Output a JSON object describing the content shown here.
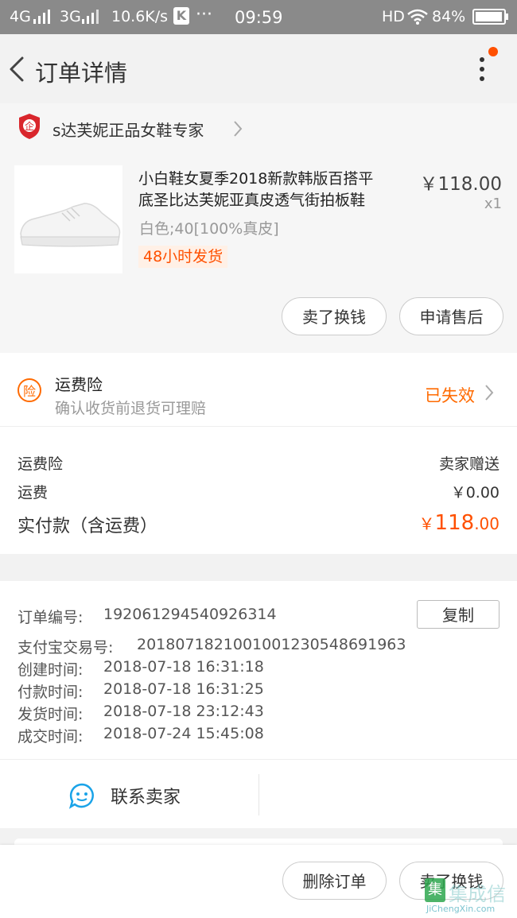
{
  "status_bar": {
    "signal_left": "4G",
    "signal_mid": "3G",
    "speed": "10.6K/s",
    "app_badge": "K",
    "dots": "···",
    "time": "09:59",
    "hd": "HD",
    "battery": "84%"
  },
  "nav": {
    "title": "订单详情",
    "accent": "#ff5000"
  },
  "store": {
    "name": "s达芙妮正品女鞋专家"
  },
  "product": {
    "title_line1": "小白鞋女夏季2018新款韩版百搭平",
    "title_line2": "底圣比达芙妮亚真皮透气街拍板鞋",
    "price": "￥118.00",
    "quantity": "x1",
    "sku": "白色;40[100%真皮]",
    "shipping_tag": "48小时发货",
    "btn_resell": "卖了换钱",
    "btn_aftersale": "申请售后"
  },
  "insurance": {
    "icon_char": "险",
    "title": "运费险",
    "subtitle": "确认收货前退货可理赔",
    "status": "已失效"
  },
  "fees": {
    "insurance_label": "运费险",
    "insurance_value": "卖家赠送",
    "shipping_label": "运费",
    "shipping_value": "￥0.00",
    "total_label": "实付款（含运费）",
    "total_currency": "￥",
    "total_int": "118",
    "total_dec": ".00"
  },
  "order_info": {
    "order_no_label": "订单编号:",
    "order_no": "192061294540926314",
    "copy_label": "复制",
    "alipay_label": "支付宝交易号:",
    "alipay_no": "2018071821001001230548691963",
    "created_label": "创建时间:",
    "created": "2018-07-18 16:31:18",
    "paid_label": "付款时间:",
    "paid": "2018-07-18 16:31:25",
    "shipped_label": "发货时间:",
    "shipped": "2018-07-18 23:12:43",
    "done_label": "成交时间:",
    "done": "2018-07-24 15:45:08"
  },
  "contact": {
    "label": "联系卖家"
  },
  "bottom": {
    "delete_label": "删除订单",
    "resell_label": "卖了换钱"
  },
  "watermark": {
    "logo_text": "集成信",
    "url_text": "JiChengXin.com"
  }
}
